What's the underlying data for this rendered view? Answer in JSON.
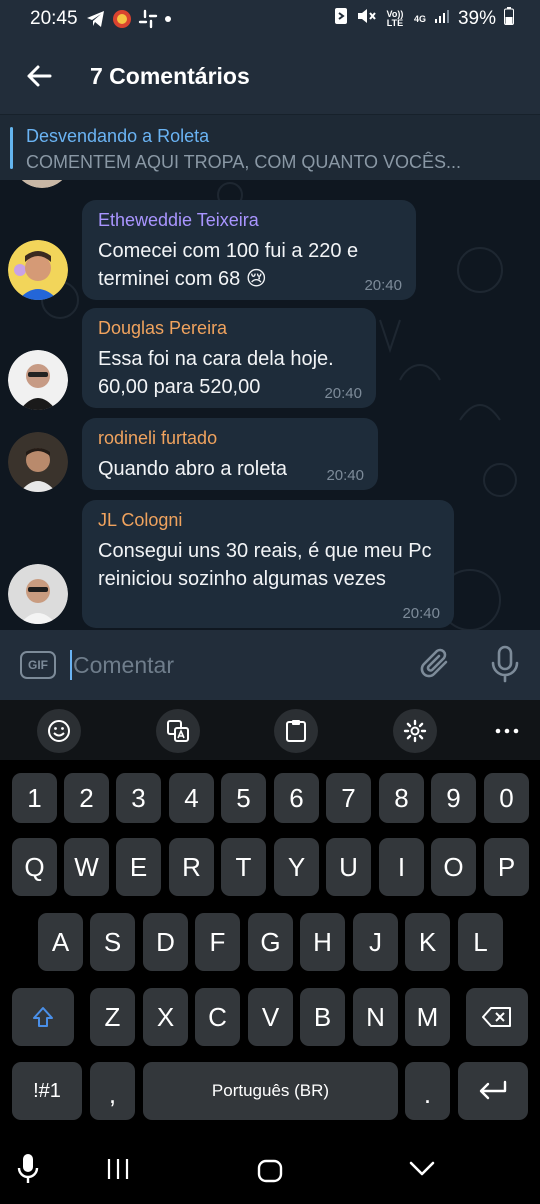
{
  "status_bar": {
    "time": "20:45",
    "volte": "Vo)) LTE",
    "net": "4G",
    "battery": "39%"
  },
  "header": {
    "title": "7 Comentários"
  },
  "pinned": {
    "title": "Desvendando a Roleta",
    "text": "COMENTEM AQUI TROPA, COM QUANTO VOCÊS..."
  },
  "messages": [
    {
      "name": "Etheweddie Teixeira",
      "name_color": "#a995ff",
      "text": "Comecei com 100  fui a 220 e terminei com 68 😢",
      "time": "20:40"
    },
    {
      "name": "Douglas Pereira",
      "name_color": "#f0a35e",
      "text": "Essa foi na cara dela hoje. 60,00 para 520,00",
      "time": "20:40"
    },
    {
      "name": "rodineli furtado",
      "name_color": "#f0a35e",
      "text": "Quando abro a roleta",
      "time": "20:40"
    },
    {
      "name": "JL Cologni",
      "name_color": "#f0a35e",
      "text": "Consegui uns 30 reais, é que meu Pc reiniciou sozinho algumas vezes",
      "time": "20:40"
    }
  ],
  "composer": {
    "gif_label": "GIF",
    "placeholder": "Comentar"
  },
  "keyboard": {
    "row_numbers": [
      "1",
      "2",
      "3",
      "4",
      "5",
      "6",
      "7",
      "8",
      "9",
      "0"
    ],
    "row1": [
      "Q",
      "W",
      "E",
      "R",
      "T",
      "Y",
      "U",
      "I",
      "O",
      "P"
    ],
    "row2": [
      "A",
      "S",
      "D",
      "F",
      "G",
      "H",
      "J",
      "K",
      "L"
    ],
    "row3": [
      "Z",
      "X",
      "C",
      "V",
      "B",
      "N",
      "M"
    ],
    "symbols_label": "!#1",
    "comma": ",",
    "space_label": "Português (BR)",
    "period": "."
  },
  "colors": {
    "accent": "#6ab3f3",
    "bubble": "#1e2c3a",
    "header": "#222d3a"
  }
}
